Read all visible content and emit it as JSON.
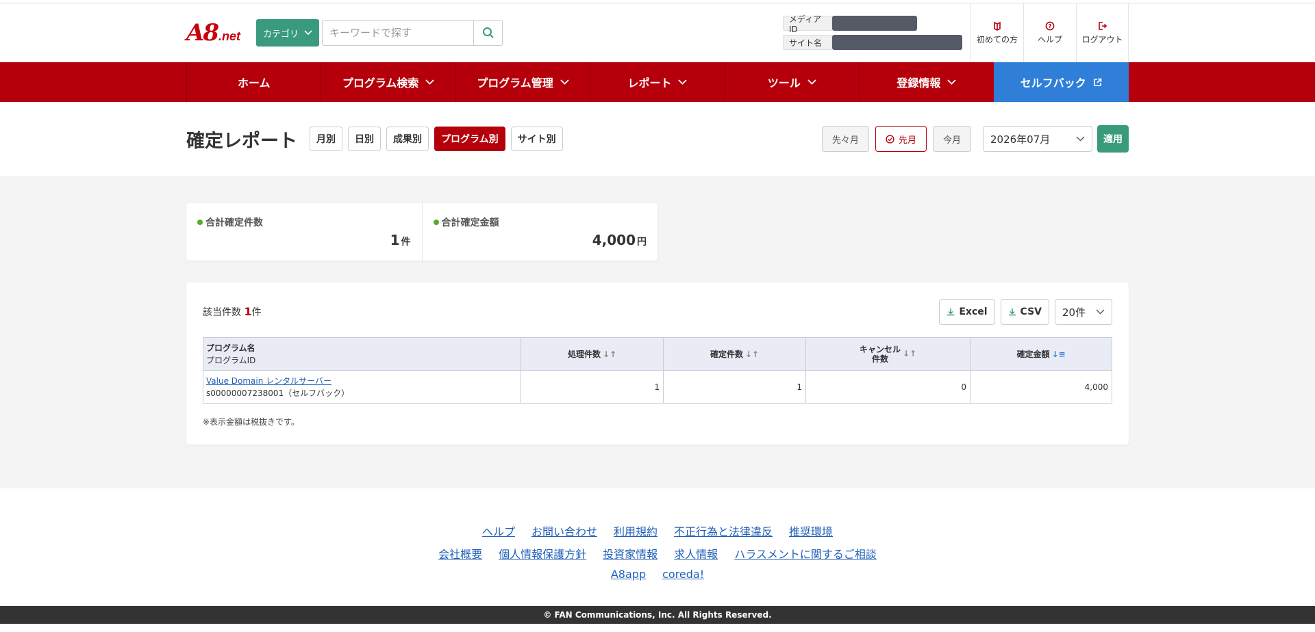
{
  "header": {
    "logo_main": "A8",
    "logo_suffix": ".net",
    "category_label": "カテゴリ",
    "search_placeholder": "キーワードで探す",
    "media_id_label": "メディアID",
    "site_name_label": "サイト名",
    "links": [
      {
        "label": "初めての方",
        "icon": "book-icon"
      },
      {
        "label": "ヘルプ",
        "icon": "help-icon"
      },
      {
        "label": "ログアウト",
        "icon": "logout-icon"
      }
    ]
  },
  "nav": {
    "items": [
      "ホーム",
      "プログラム検索",
      "プログラム管理",
      "レポート",
      "ツール",
      "登録情報"
    ],
    "selfback": "セルフバック"
  },
  "titlebar": {
    "title": "確定レポート",
    "tabs": [
      "月別",
      "日別",
      "成果別",
      "プログラム別",
      "サイト別"
    ],
    "active_tab": "プログラム別",
    "period_buttons": [
      "先々月",
      "先月",
      "今月"
    ],
    "selected_period": "先月",
    "month": "2026年07月",
    "apply": "適用"
  },
  "summary": {
    "total_count_label": "合計確定件数",
    "total_count": "1",
    "count_unit": "件",
    "total_amount_label": "合計確定金額",
    "total_amount": "4,000",
    "amount_unit": "円"
  },
  "results": {
    "count_prefix": "該当件数",
    "count": "1",
    "count_suffix": "件",
    "excel": "Excel",
    "csv": "CSV",
    "per_page": "20件",
    "columns": {
      "program_name": "プログラム名",
      "program_id": "プログラムID",
      "processed": "処理件数",
      "confirmed": "確定件数",
      "cancel_1": "キャンセル",
      "cancel_2": "件数",
      "amount": "確定金額"
    },
    "rows": [
      {
        "program_name": "Value Domain レンタルサーバー",
        "program_id": "s00000007238001（セルフバック）",
        "processed": "1",
        "confirmed": "1",
        "cancel": "0",
        "amount": "4,000"
      }
    ],
    "note": "※表示金額は税抜きです。"
  },
  "footer": {
    "row1": [
      "ヘルプ",
      "お問い合わせ",
      "利用規約",
      "不正行為と法律違反",
      "推奨環境"
    ],
    "row2": [
      "会社概要",
      "個人情報保護方針",
      "投資家情報",
      "求人情報",
      "ハラスメントに関するご相談"
    ],
    "row3": [
      "A8app",
      "coreda!"
    ],
    "copyright": "© FAN Communications, Inc. All Rights Reserved."
  },
  "colors": {
    "brand_red": "#b5000b",
    "green": "#3a9a7c",
    "blue": "#2f7fd8"
  }
}
